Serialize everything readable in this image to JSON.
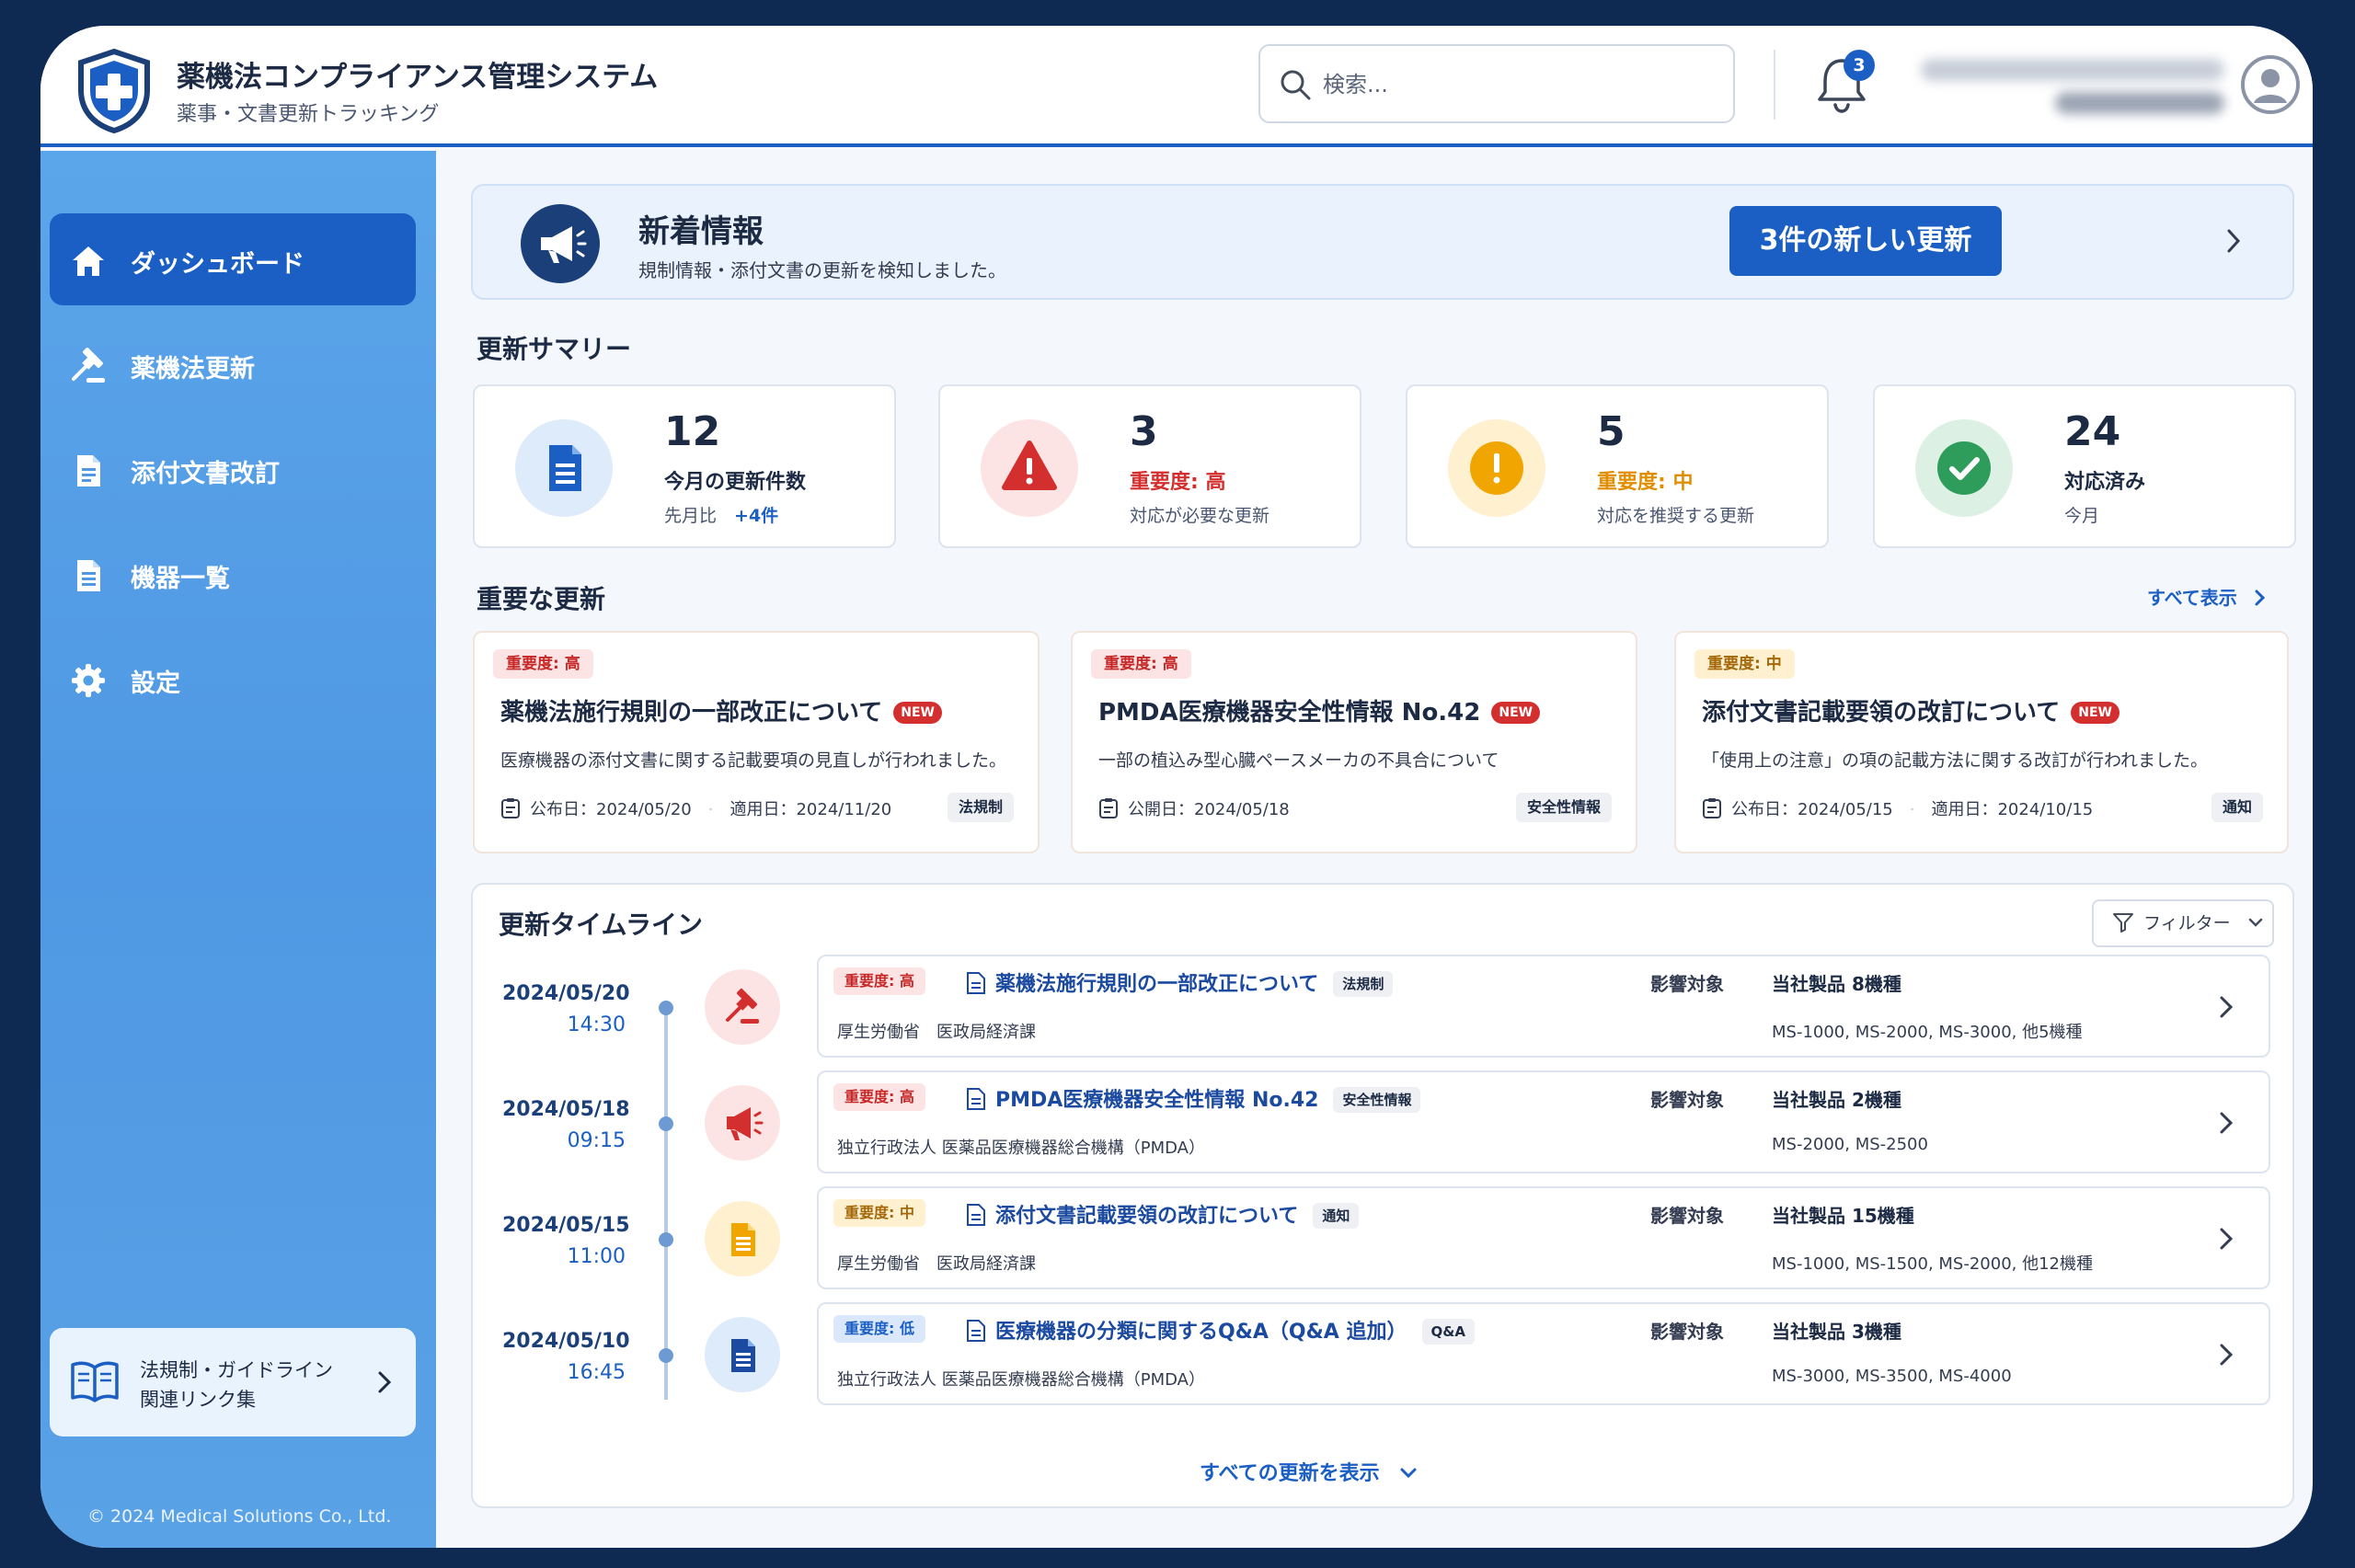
{
  "header": {
    "title": "薬機法コンプライアンス管理システム",
    "subtitle": "薬事・文書更新トラッキング",
    "search_placeholder": "検索...",
    "notification_count": "3"
  },
  "sidebar": {
    "items": [
      {
        "label": "ダッシュボード",
        "icon": "home-icon",
        "active": true
      },
      {
        "label": "薬機法更新",
        "icon": "gavel-icon"
      },
      {
        "label": "添付文書改訂",
        "icon": "document-icon"
      },
      {
        "label": "機器一覧",
        "icon": "list-document-icon"
      },
      {
        "label": "設定",
        "icon": "gear-icon"
      }
    ],
    "link": {
      "line1": "法規制・ガイドライン",
      "line2": "関連リンク集"
    },
    "copyright": "© 2024 Medical Solutions Co., Ltd."
  },
  "banner": {
    "title": "新着情報",
    "subtitle": "規制情報・添付文書の更新を検知しました。",
    "button": "3件の新しい更新"
  },
  "summary": {
    "title": "更新サマリー",
    "stats": [
      {
        "value": "12",
        "label": "今月の更新件数",
        "sub": "先月比",
        "delta": "+4件",
        "color": "#1b5fc4"
      },
      {
        "value": "3",
        "label": "重要度: 高",
        "sub": "対応が必要な更新",
        "color": "#d32f2f"
      },
      {
        "value": "5",
        "label": "重要度: 中",
        "sub": "対応を推奨する更新",
        "color": "#f0a500"
      },
      {
        "value": "24",
        "label": "対応済み",
        "sub": "今月",
        "color": "#2e9d5b"
      }
    ]
  },
  "important": {
    "title": "重要な更新",
    "show_all": "すべて表示",
    "new_label": "NEW",
    "cards": [
      {
        "badge": "重要度: 高",
        "title": "薬機法施行規則の一部改正について",
        "desc": "医療機器の添付文書に関する記載要項の見直しが行われました。",
        "date1": "公布日：2024/05/20",
        "date2": "適用日：2024/11/20",
        "tag": "法規制"
      },
      {
        "badge": "重要度: 高",
        "title": "PMDA医療機器安全性情報 No.42",
        "desc": "一部の植込み型心臓ペースメーカの不具合について",
        "date1": "公開日：2024/05/18",
        "date2": "",
        "tag": "安全性情報"
      },
      {
        "badge": "重要度: 中",
        "title": "添付文書記載要領の改訂について",
        "desc": "「使用上の注意」の項の記載方法に関する改訂が行われました。",
        "date1": "公布日：2024/05/15",
        "date2": "適用日：2024/10/15",
        "tag": "通知"
      }
    ]
  },
  "timeline": {
    "title": "更新タイムライン",
    "filter": "フィルター",
    "impact_label": "影響対象",
    "show_more": "すべての更新を表示",
    "rows": [
      {
        "date": "2024/05/20",
        "time": "14:30",
        "badge": "重要度: 高",
        "title": "薬機法施行規則の一部改正について",
        "tag": "法規制",
        "source": "厚生労働省　医政局経済課",
        "count": "当社製品 8機種",
        "models": "MS-1000, MS-2000, MS-3000, 他5機種"
      },
      {
        "date": "2024/05/18",
        "time": "09:15",
        "badge": "重要度: 高",
        "title": "PMDA医療機器安全性情報 No.42",
        "tag": "安全性情報",
        "source": "独立行政法人 医薬品医療機器総合機構（PMDA）",
        "count": "当社製品 2機種",
        "models": "MS-2000, MS-2500"
      },
      {
        "date": "2024/05/15",
        "time": "11:00",
        "badge": "重要度: 中",
        "title": "添付文書記載要領の改訂について",
        "tag": "通知",
        "source": "厚生労働省　医政局経済課",
        "count": "当社製品 15機種",
        "models": "MS-1000, MS-1500, MS-2000, 他12機種"
      },
      {
        "date": "2024/05/10",
        "time": "16:45",
        "badge": "重要度: 低",
        "title": "医療機器の分類に関するQ&A（Q&A 追加）",
        "tag": "Q&A",
        "source": "独立行政法人 医薬品医療機器総合機構（PMDA）",
        "count": "当社製品 3機種",
        "models": "MS-3000, MS-3500, MS-4000"
      }
    ]
  }
}
